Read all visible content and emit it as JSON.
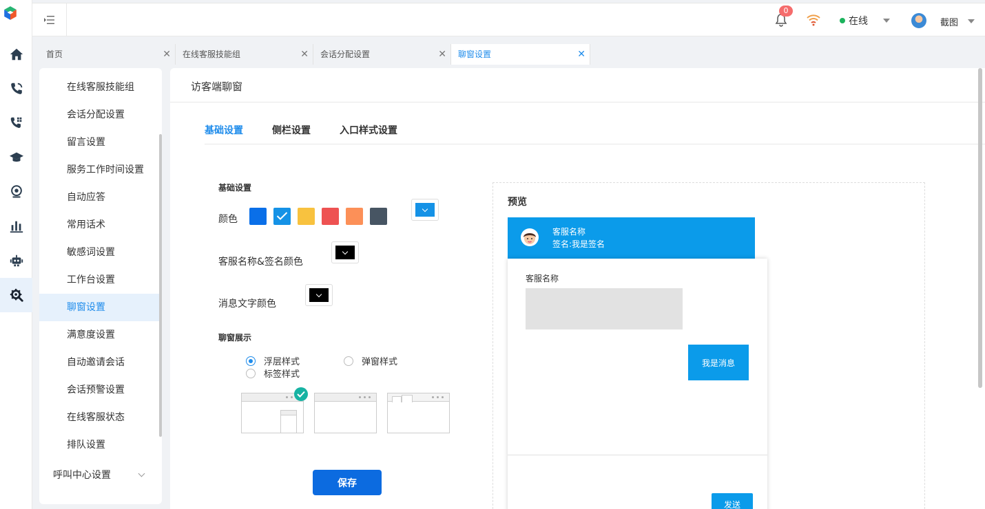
{
  "header": {
    "notification_count": "0",
    "status_label": "在线",
    "user_name": "截图"
  },
  "rail": {
    "icons": [
      "home-icon",
      "call-icon",
      "phone-grid-icon",
      "graduation-cap-icon",
      "monitor-icon",
      "bar-chart-icon",
      "robot-icon",
      "settings-tools-icon"
    ],
    "active_index": 7
  },
  "tabs": [
    {
      "label": "首页"
    },
    {
      "label": "在线客服技能组"
    },
    {
      "label": "会话分配设置"
    },
    {
      "label": "聊窗设置"
    }
  ],
  "subnav": {
    "items": [
      {
        "label": "在线客服技能组"
      },
      {
        "label": "会话分配设置"
      },
      {
        "label": "留言设置"
      },
      {
        "label": "服务工作时间设置"
      },
      {
        "label": "自动应答"
      },
      {
        "label": "常用话术"
      },
      {
        "label": "敏感词设置"
      },
      {
        "label": "工作台设置"
      },
      {
        "label": "聊窗设置"
      },
      {
        "label": "满意度设置"
      },
      {
        "label": "自动邀请会话"
      },
      {
        "label": "会话预警设置"
      },
      {
        "label": "在线客服状态"
      },
      {
        "label": "排队设置"
      }
    ],
    "active_index": 8,
    "group_label": "呼叫中心设置"
  },
  "main": {
    "title": "访客端聊窗",
    "sub_tabs": [
      {
        "label": "基础设置"
      },
      {
        "label": "侧栏设置"
      },
      {
        "label": "入口样式设置"
      }
    ],
    "basic_section": "基础设置",
    "color_label": "颜色",
    "colors": [
      "#0a6fe8",
      "#1592e6",
      "#f8c23f",
      "#ee5252",
      "#fc9058",
      "#475563"
    ],
    "selected_color_index": 1,
    "custom_color": "#1592e6",
    "name_sign_color_label": "客服名称&签名颜色",
    "name_sign_color": "#000000",
    "msg_text_color_label": "消息文字颜色",
    "msg_text_color": "#000000",
    "display_section": "聊窗展示",
    "display_options": [
      {
        "label": "浮层样式",
        "selected": true
      },
      {
        "label": "弹窗样式",
        "selected": false
      },
      {
        "label": "标签样式",
        "selected": false
      }
    ],
    "save_label": "保存"
  },
  "preview": {
    "title": "预览",
    "agent_name": "客服名称",
    "signature": "签名:我是签名",
    "message_agent_name": "客服名称",
    "message_text": "我是消息",
    "send_label": "发送"
  }
}
